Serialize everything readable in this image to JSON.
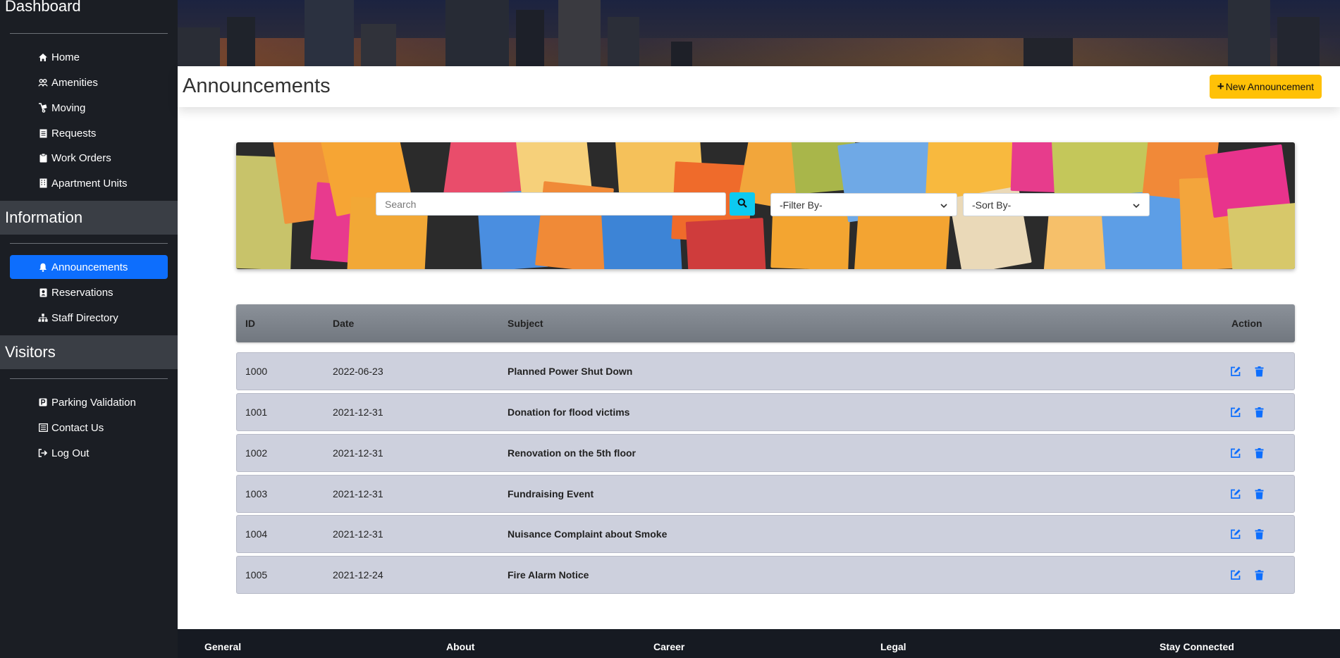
{
  "sidebar": {
    "dashboard_title": "Dashboard",
    "dashboard_items": [
      {
        "label": "Home",
        "icon": "home-icon"
      },
      {
        "label": "Amenities",
        "icon": "amenities-icon"
      },
      {
        "label": "Moving",
        "icon": "dolly-icon"
      },
      {
        "label": "Requests",
        "icon": "document-icon"
      },
      {
        "label": "Work Orders",
        "icon": "clipboard-icon"
      },
      {
        "label": "Apartment Units",
        "icon": "building-icon"
      }
    ],
    "information_title": "Information",
    "information_items": [
      {
        "label": "Announcements",
        "icon": "bell-icon",
        "active": true
      },
      {
        "label": "Reservations",
        "icon": "id-card-icon"
      },
      {
        "label": "Staff Directory",
        "icon": "org-chart-icon"
      }
    ],
    "visitors_title": "Visitors",
    "visitors_items": [
      {
        "label": "Parking Validation",
        "icon": "parking-icon"
      },
      {
        "label": "Contact Us",
        "icon": "address-book-icon"
      },
      {
        "label": "Log Out",
        "icon": "sign-out-icon"
      }
    ],
    "active_color": "#0d6efd"
  },
  "header": {
    "page_title": "Announcements",
    "new_button_label": "New Announcement",
    "new_button_color": "#ffc107"
  },
  "search": {
    "placeholder": "Search",
    "filter_label": "-Filter By-",
    "sort_label": "-Sort By-",
    "button_color": "#0dcaf0"
  },
  "table": {
    "columns": {
      "id": "ID",
      "date": "Date",
      "subject": "Subject",
      "action": "Action"
    },
    "rows": [
      {
        "id": "1000",
        "date": "2022-06-23",
        "subject": "Planned Power Shut Down"
      },
      {
        "id": "1001",
        "date": "2021-12-31",
        "subject": "Donation for flood victims"
      },
      {
        "id": "1002",
        "date": "2021-12-31",
        "subject": "Renovation on the 5th floor"
      },
      {
        "id": "1003",
        "date": "2021-12-31",
        "subject": "Fundraising Event"
      },
      {
        "id": "1004",
        "date": "2021-12-31",
        "subject": "Nuisance Complaint about Smoke"
      },
      {
        "id": "1005",
        "date": "2021-12-24",
        "subject": "Fire Alarm Notice"
      }
    ]
  },
  "footer": {
    "general": "General",
    "about": "About",
    "career": "Career",
    "legal": "Legal",
    "stay_connected": "Stay Connected"
  }
}
